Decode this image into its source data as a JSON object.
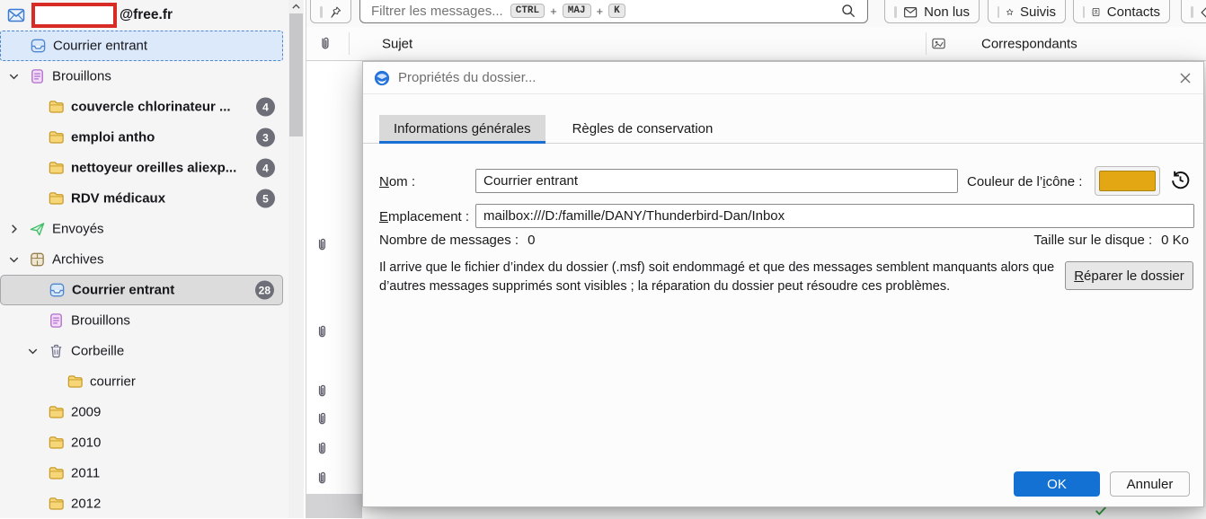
{
  "colors": {
    "accent_blue": "#1a6fd4",
    "ok_button_blue": "#1271d3",
    "folder_icon_gold": "#e2a712",
    "unread_badge_gray": "#6e6e78",
    "redaction_red": "#d92b25"
  },
  "sidebar": {
    "account": {
      "domain_label": "@free.fr"
    },
    "items": [
      {
        "id": "inbox",
        "level": 1,
        "icon": "inbox",
        "label": "Courrier entrant",
        "selected": "focus"
      },
      {
        "id": "drafts",
        "level": 1,
        "icon": "drafts",
        "label": "Brouillons",
        "expander": "down"
      },
      {
        "id": "couvercle-chlorinateur",
        "level": 2,
        "icon": "folder",
        "label": "couvercle chlorinateur ...",
        "badge": "4",
        "bold": true
      },
      {
        "id": "emploi-antho",
        "level": 2,
        "icon": "folder",
        "label": "emploi antho",
        "badge": "3",
        "bold": true
      },
      {
        "id": "nettoyeur-oreilles",
        "level": 2,
        "icon": "folder",
        "label": "nettoyeur oreilles aliexp...",
        "badge": "4",
        "bold": true
      },
      {
        "id": "rdv-medicaux",
        "level": 2,
        "icon": "folder",
        "label": "RDV médicaux",
        "badge": "5",
        "bold": true
      },
      {
        "id": "envoyes",
        "level": 1,
        "icon": "sent",
        "label": "Envoyés",
        "expander": "right"
      },
      {
        "id": "archives",
        "level": 1,
        "icon": "archive",
        "label": "Archives",
        "expander": "down"
      },
      {
        "id": "archives-courrier-entrant",
        "level": 2,
        "icon": "inbox",
        "label": "Courrier entrant",
        "badge": "28",
        "bold": true,
        "selected": "active"
      },
      {
        "id": "archives-brouillons",
        "level": 2,
        "icon": "drafts",
        "label": "Brouillons"
      },
      {
        "id": "corbeille",
        "level": 2,
        "icon": "trash",
        "label": "Corbeille",
        "expander": "down"
      },
      {
        "id": "courrier",
        "level": 3,
        "icon": "folder",
        "label": "courrier"
      },
      {
        "id": "2009",
        "level": 2,
        "icon": "folder",
        "label": "2009"
      },
      {
        "id": "2010",
        "level": 2,
        "icon": "folder",
        "label": "2010"
      },
      {
        "id": "2011",
        "level": 2,
        "icon": "folder",
        "label": "2011"
      },
      {
        "id": "2012",
        "level": 2,
        "icon": "folder",
        "label": "2012"
      }
    ]
  },
  "quickfilter": {
    "placeholder": "Filtrer les messages...",
    "shortcut_keys": [
      "CTRL",
      "MAJ",
      "K"
    ],
    "shortcut_joiner": "+",
    "buttons": [
      {
        "icon": "mail-unread",
        "label": "Non lus"
      },
      {
        "icon": "star",
        "label": "Suivis"
      },
      {
        "icon": "address-book",
        "label": "Contacts"
      },
      {
        "icon": "tag",
        "label": ""
      }
    ]
  },
  "list_header": {
    "subject_label": "Sujet",
    "correspondents_label": "Correspondants"
  },
  "message_list": {
    "visible_attachment_rows": 6
  },
  "dialog": {
    "title": "Propriétés du dossier...",
    "tabs": [
      {
        "label": "Informations générales",
        "active": true
      },
      {
        "label": "Règles de conservation",
        "active": false
      }
    ],
    "fields": {
      "name_label": "Nom :",
      "name_key": "N",
      "name_value": "Courrier entrant",
      "color_label": "Couleur de l’icône :",
      "color_key": "i",
      "icon_color": "#e2a712",
      "location_label": "Emplacement :",
      "location_key": "E",
      "location_value": "mailbox:///D:/famille/DANY/Thunderbird-Dan/Inbox",
      "message_count_label": "Nombre de messages :",
      "message_count": "0",
      "disk_size_label": "Taille sur le disque :",
      "disk_size": "0 Ko"
    },
    "repair": {
      "text": "Il arrive que le fichier d’index du dossier (.msf) soit endommagé et que des messages semblent manquants alors que d’autres messages supprimés sont visibles ; la réparation du dossier peut résoudre ces problèmes.",
      "button_label": "Réparer le dossier",
      "button_key": "R"
    },
    "footer": {
      "ok_label": "OK",
      "cancel_label": "Annuler"
    }
  }
}
